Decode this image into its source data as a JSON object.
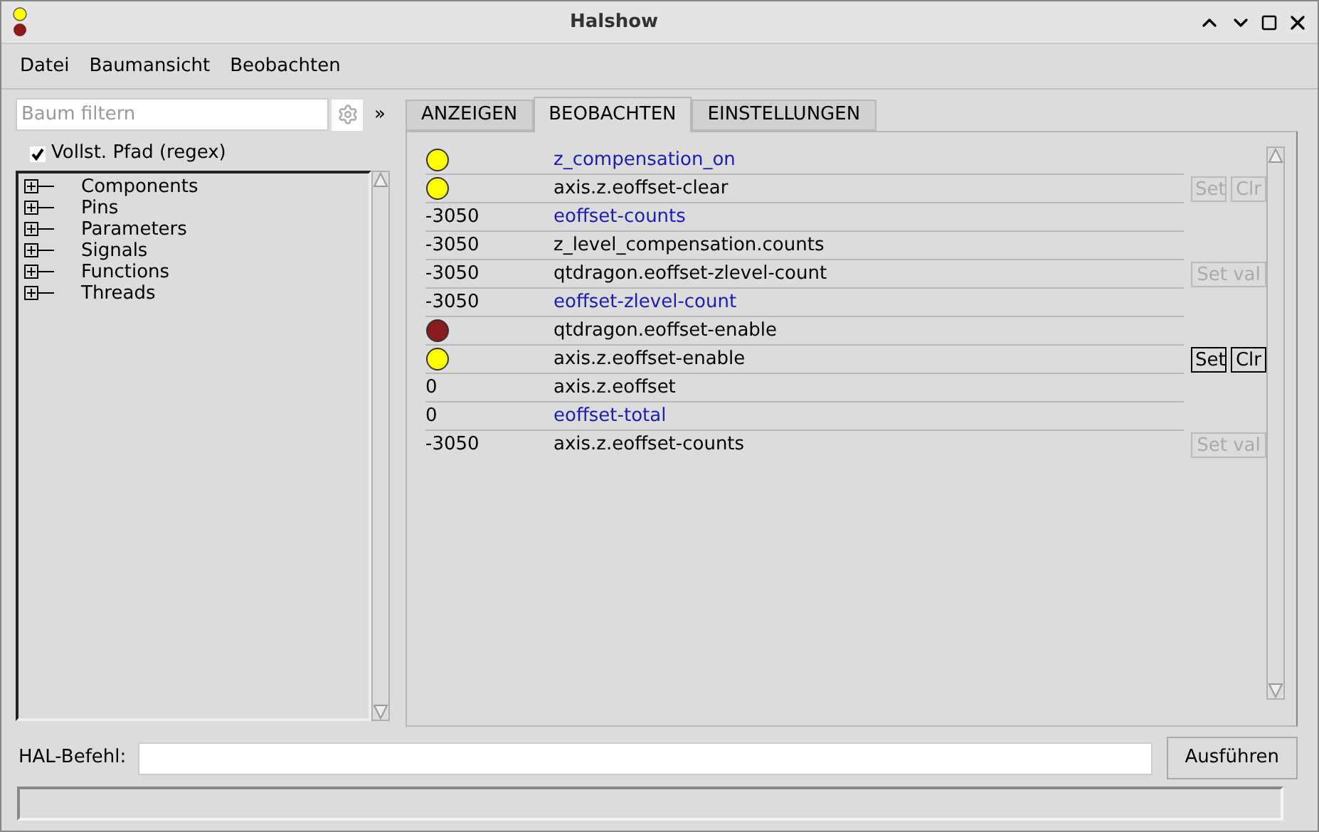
{
  "window": {
    "title": "Halshow"
  },
  "menu": [
    "Datei",
    "Baumansicht",
    "Beobachten"
  ],
  "filter": {
    "placeholder": "Baum filtern",
    "more": "»"
  },
  "full_path": {
    "label": "Vollst. Pfad (regex)",
    "checked": true
  },
  "tree": [
    {
      "label": "Components",
      "expanded": false
    },
    {
      "label": "Pins",
      "expanded": false
    },
    {
      "label": "Parameters",
      "expanded": false
    },
    {
      "label": "Signals",
      "expanded": false
    },
    {
      "label": "Functions",
      "expanded": false
    },
    {
      "label": "Threads",
      "expanded": false
    }
  ],
  "tabs": [
    {
      "label": "ANZEIGEN",
      "selected": false
    },
    {
      "label": "BEOBACHTEN",
      "selected": true
    },
    {
      "label": "EINSTELLUNGEN",
      "selected": false
    }
  ],
  "watch": [
    {
      "kind": "led",
      "color": "#ffff00",
      "name": "z_compensation_on",
      "highlighted": true
    },
    {
      "kind": "led",
      "color": "#ffff00",
      "name": "axis.z.eoffset-clear",
      "highlighted": false,
      "buttons": [
        {
          "label": "Set",
          "disabled": true
        },
        {
          "label": "Clr",
          "disabled": true
        }
      ]
    },
    {
      "kind": "value",
      "value": "-3050",
      "name": "eoffset-counts",
      "highlighted": true
    },
    {
      "kind": "value",
      "value": "-3050",
      "name": "z_level_compensation.counts",
      "highlighted": false
    },
    {
      "kind": "value",
      "value": "-3050",
      "name": "qtdragon.eoffset-zlevel-count",
      "highlighted": false,
      "buttons": [
        {
          "label": "Set val",
          "disabled": true
        }
      ]
    },
    {
      "kind": "value",
      "value": "-3050",
      "name": "eoffset-zlevel-count",
      "highlighted": true
    },
    {
      "kind": "led",
      "color": "#8b1a1a",
      "name": "qtdragon.eoffset-enable",
      "highlighted": false
    },
    {
      "kind": "led",
      "color": "#ffff00",
      "name": "axis.z.eoffset-enable",
      "highlighted": false,
      "buttons": [
        {
          "label": "Set",
          "disabled": false
        },
        {
          "label": "Clr",
          "disabled": false
        }
      ]
    },
    {
      "kind": "value",
      "value": "0",
      "name": "axis.z.eoffset",
      "highlighted": false
    },
    {
      "kind": "value",
      "value": "0",
      "name": "eoffset-total",
      "highlighted": true
    },
    {
      "kind": "value",
      "value": "-3050",
      "name": "axis.z.eoffset-counts",
      "highlighted": false,
      "buttons": [
        {
          "label": "Set val",
          "disabled": true
        }
      ]
    }
  ],
  "command": {
    "label": "HAL-Befehl:",
    "button": "Ausführen"
  }
}
